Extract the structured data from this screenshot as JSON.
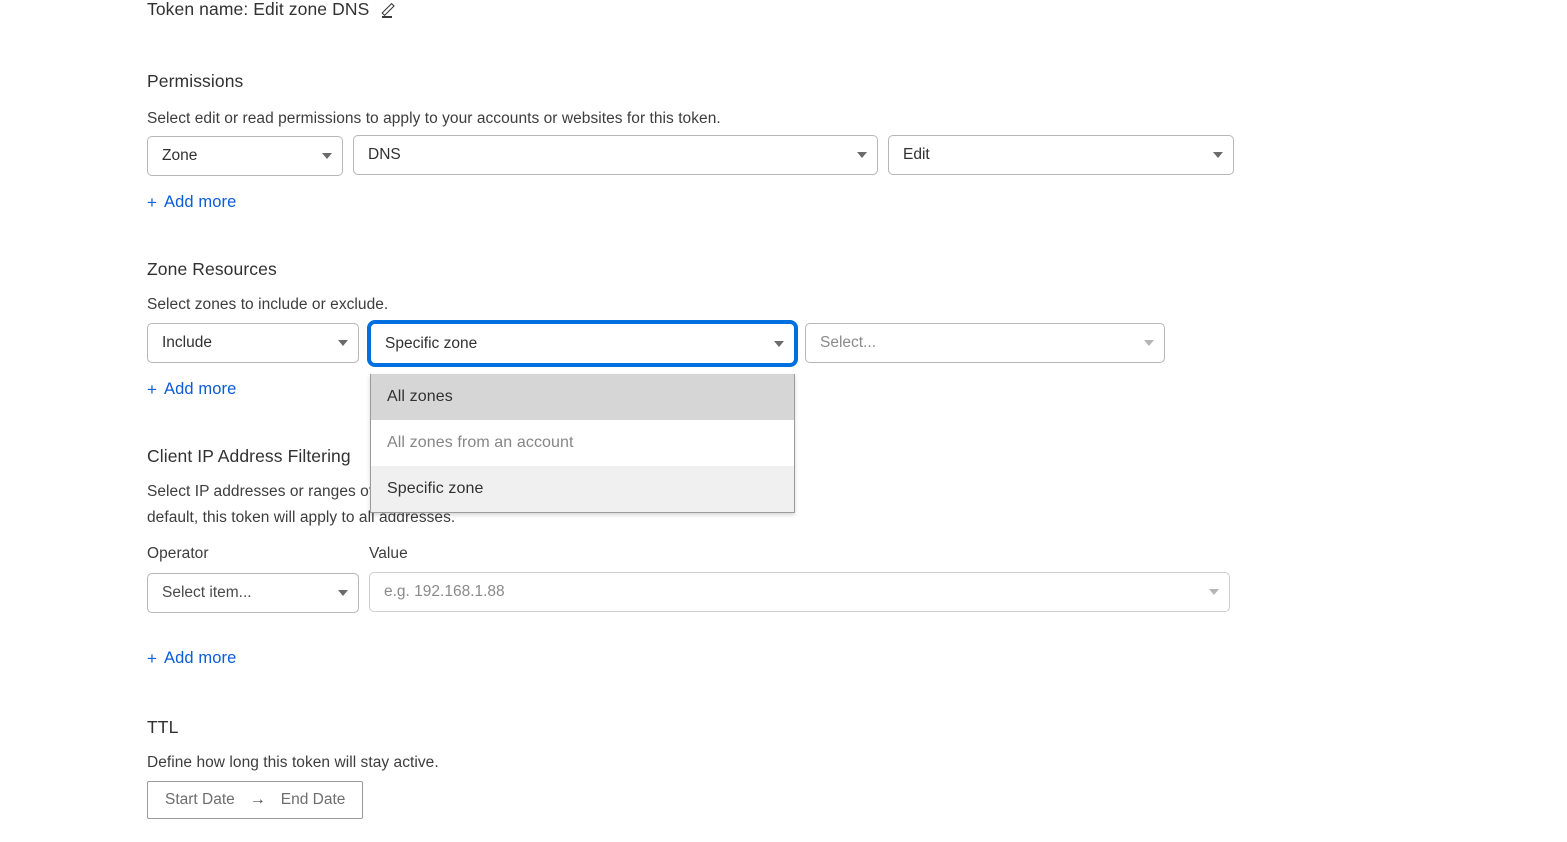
{
  "token": {
    "name_label": "Token name: Edit zone DNS",
    "edit_icon": "pencil-icon"
  },
  "permissions": {
    "title": "Permissions",
    "description": "Select edit or read permissions to apply to your accounts or websites for this token.",
    "scope_value": "Zone",
    "resource_value": "DNS",
    "access_value": "Edit",
    "add_more_label": "Add more",
    "add_more_plus": "+"
  },
  "zone_resources": {
    "title": "Zone Resources",
    "description": "Select zones to include or exclude.",
    "mode_value": "Include",
    "scope_value": "Specific zone",
    "target_placeholder": "Select...",
    "add_more_label": "Add more",
    "add_more_plus": "+",
    "dropdown": {
      "open": true,
      "options": [
        {
          "label": "All zones",
          "state": "highlighted"
        },
        {
          "label": "All zones from an account",
          "state": "disabled"
        },
        {
          "label": "Specific zone",
          "state": "selected"
        }
      ]
    }
  },
  "client_ip_filtering": {
    "title": "Client IP Address Filtering",
    "description_line1": "Select IP addresses or ranges of IP addresses that can use the API token with Cloudflare. By",
    "description_line2": "default, this token will apply to all addresses.",
    "operator_label": "Operator",
    "value_label": "Value",
    "operator_placeholder": "Select item...",
    "value_placeholder": "e.g. 192.168.1.88",
    "add_more_label": "Add more",
    "add_more_plus": "+"
  },
  "ttl": {
    "title": "TTL",
    "description": "Define how long this token will stay active.",
    "start_date_label": "Start Date",
    "arrow_glyph": "→",
    "end_date_label": "End Date"
  },
  "colors": {
    "link": "#0b5cd5",
    "focus_ring": "#0070e0",
    "text": "#313131",
    "muted": "#8a8a8a",
    "border": "#b6b6b6",
    "dropdown_highlight": "#d6d6d6",
    "dropdown_selected": "#f0f0f0"
  }
}
